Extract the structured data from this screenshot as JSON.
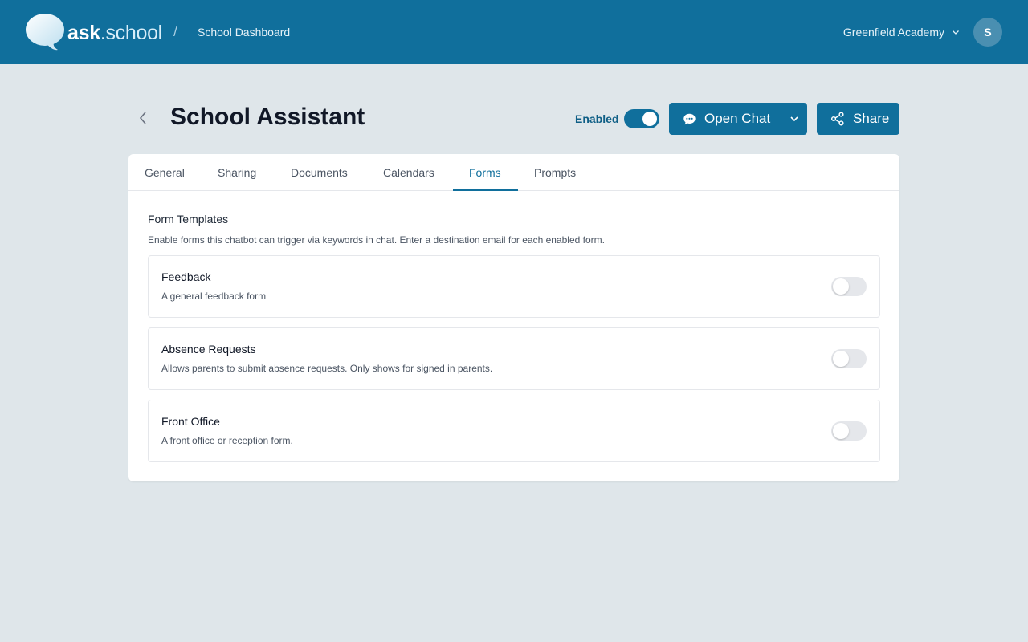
{
  "header": {
    "logo_bold": "ask",
    "logo_rest": ".school",
    "breadcrumb_separator": "/",
    "breadcrumb": "School Dashboard",
    "organization": "Greenfield Academy",
    "avatar_initial": "S"
  },
  "page": {
    "title": "School Assistant",
    "enabled_label": "Enabled",
    "enabled": true,
    "open_chat_label": "Open Chat",
    "share_label": "Share"
  },
  "tabs": [
    {
      "label": "General",
      "active": false
    },
    {
      "label": "Sharing",
      "active": false
    },
    {
      "label": "Documents",
      "active": false
    },
    {
      "label": "Calendars",
      "active": false
    },
    {
      "label": "Forms",
      "active": true
    },
    {
      "label": "Prompts",
      "active": false
    }
  ],
  "forms_section": {
    "title": "Form Templates",
    "description": "Enable forms this chatbot can trigger via keywords in chat. Enter a destination email for each enabled form.",
    "items": [
      {
        "name": "Feedback",
        "description": "A general feedback form",
        "enabled": false
      },
      {
        "name": "Absence Requests",
        "description": "Allows parents to submit absence requests. Only shows for signed in parents.",
        "enabled": false
      },
      {
        "name": "Front Office",
        "description": "A front office or reception form.",
        "enabled": false
      }
    ]
  },
  "colors": {
    "brand": "#106f9c",
    "background": "#dfe6ea",
    "card": "#ffffff"
  },
  "icons": {
    "logo": "speech-bubble-logo",
    "back": "chevron-left-icon",
    "chat": "chat-bubble-icon",
    "caret": "chevron-down-icon",
    "share": "share-icon",
    "org_caret": "chevron-down-icon"
  }
}
